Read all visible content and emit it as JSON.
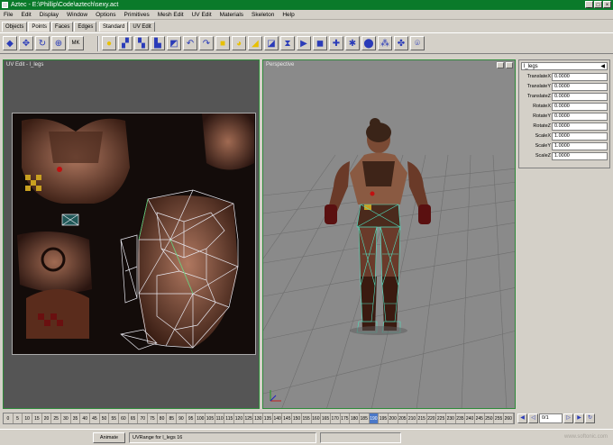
{
  "window": {
    "title": "Aztec - E:\\Phillip\\Code\\aztech\\sexy.act"
  },
  "menu": [
    "File",
    "Edit",
    "Display",
    "Window",
    "Options",
    "Primitives",
    "Mesh Edit",
    "UV Edit",
    "Materials",
    "Skeleton",
    "Help"
  ],
  "mode_tabs": [
    "Objects",
    "Points",
    "Faces",
    "Edges"
  ],
  "tool_tabs": [
    "Standard",
    "UV Edit"
  ],
  "toolbar": {
    "mini_label": "MK"
  },
  "uv_panel": {
    "title": "UV Edit - l_legs"
  },
  "perspective_panel": {
    "title": "Perspective"
  },
  "properties": {
    "object": "l_legs",
    "rows": [
      {
        "label": "TranslateX",
        "value": "0.0000"
      },
      {
        "label": "TranslateY",
        "value": "0.0000"
      },
      {
        "label": "TranslateZ",
        "value": "0.0000"
      },
      {
        "label": "RotateX",
        "value": "0.0000"
      },
      {
        "label": "RotateY",
        "value": "0.0000"
      },
      {
        "label": "RotateZ",
        "value": "0.0000"
      },
      {
        "label": "ScaleX",
        "value": "1.0000"
      },
      {
        "label": "ScaleY",
        "value": "1.0000"
      },
      {
        "label": "ScaleZ",
        "value": "1.0000"
      }
    ]
  },
  "timeline": {
    "frames": [
      "0",
      "5",
      "10",
      "15",
      "20",
      "25",
      "30",
      "35",
      "40",
      "45",
      "50",
      "55",
      "60",
      "65",
      "70",
      "75",
      "80",
      "85",
      "90",
      "95",
      "100",
      "105",
      "110",
      "115",
      "120",
      "125",
      "130",
      "135",
      "140",
      "145",
      "150",
      "155",
      "160",
      "165",
      "170",
      "175",
      "180",
      "185",
      "190",
      "195",
      "200",
      "205",
      "210",
      "215",
      "220",
      "225",
      "230",
      "235",
      "240",
      "245",
      "250",
      "255",
      "260"
    ],
    "current_index": 38,
    "frame_field": "0/1"
  },
  "status": {
    "button": "Animate",
    "message": "UVRange for l_legs 16"
  },
  "watermark": "www.softonic.com",
  "colors": {
    "title_bar": "#0a7a2a",
    "panel_border": "#2e8a3a",
    "timeline_current": "#4a78c8",
    "toolbar_icon": "#2a3bb8"
  }
}
